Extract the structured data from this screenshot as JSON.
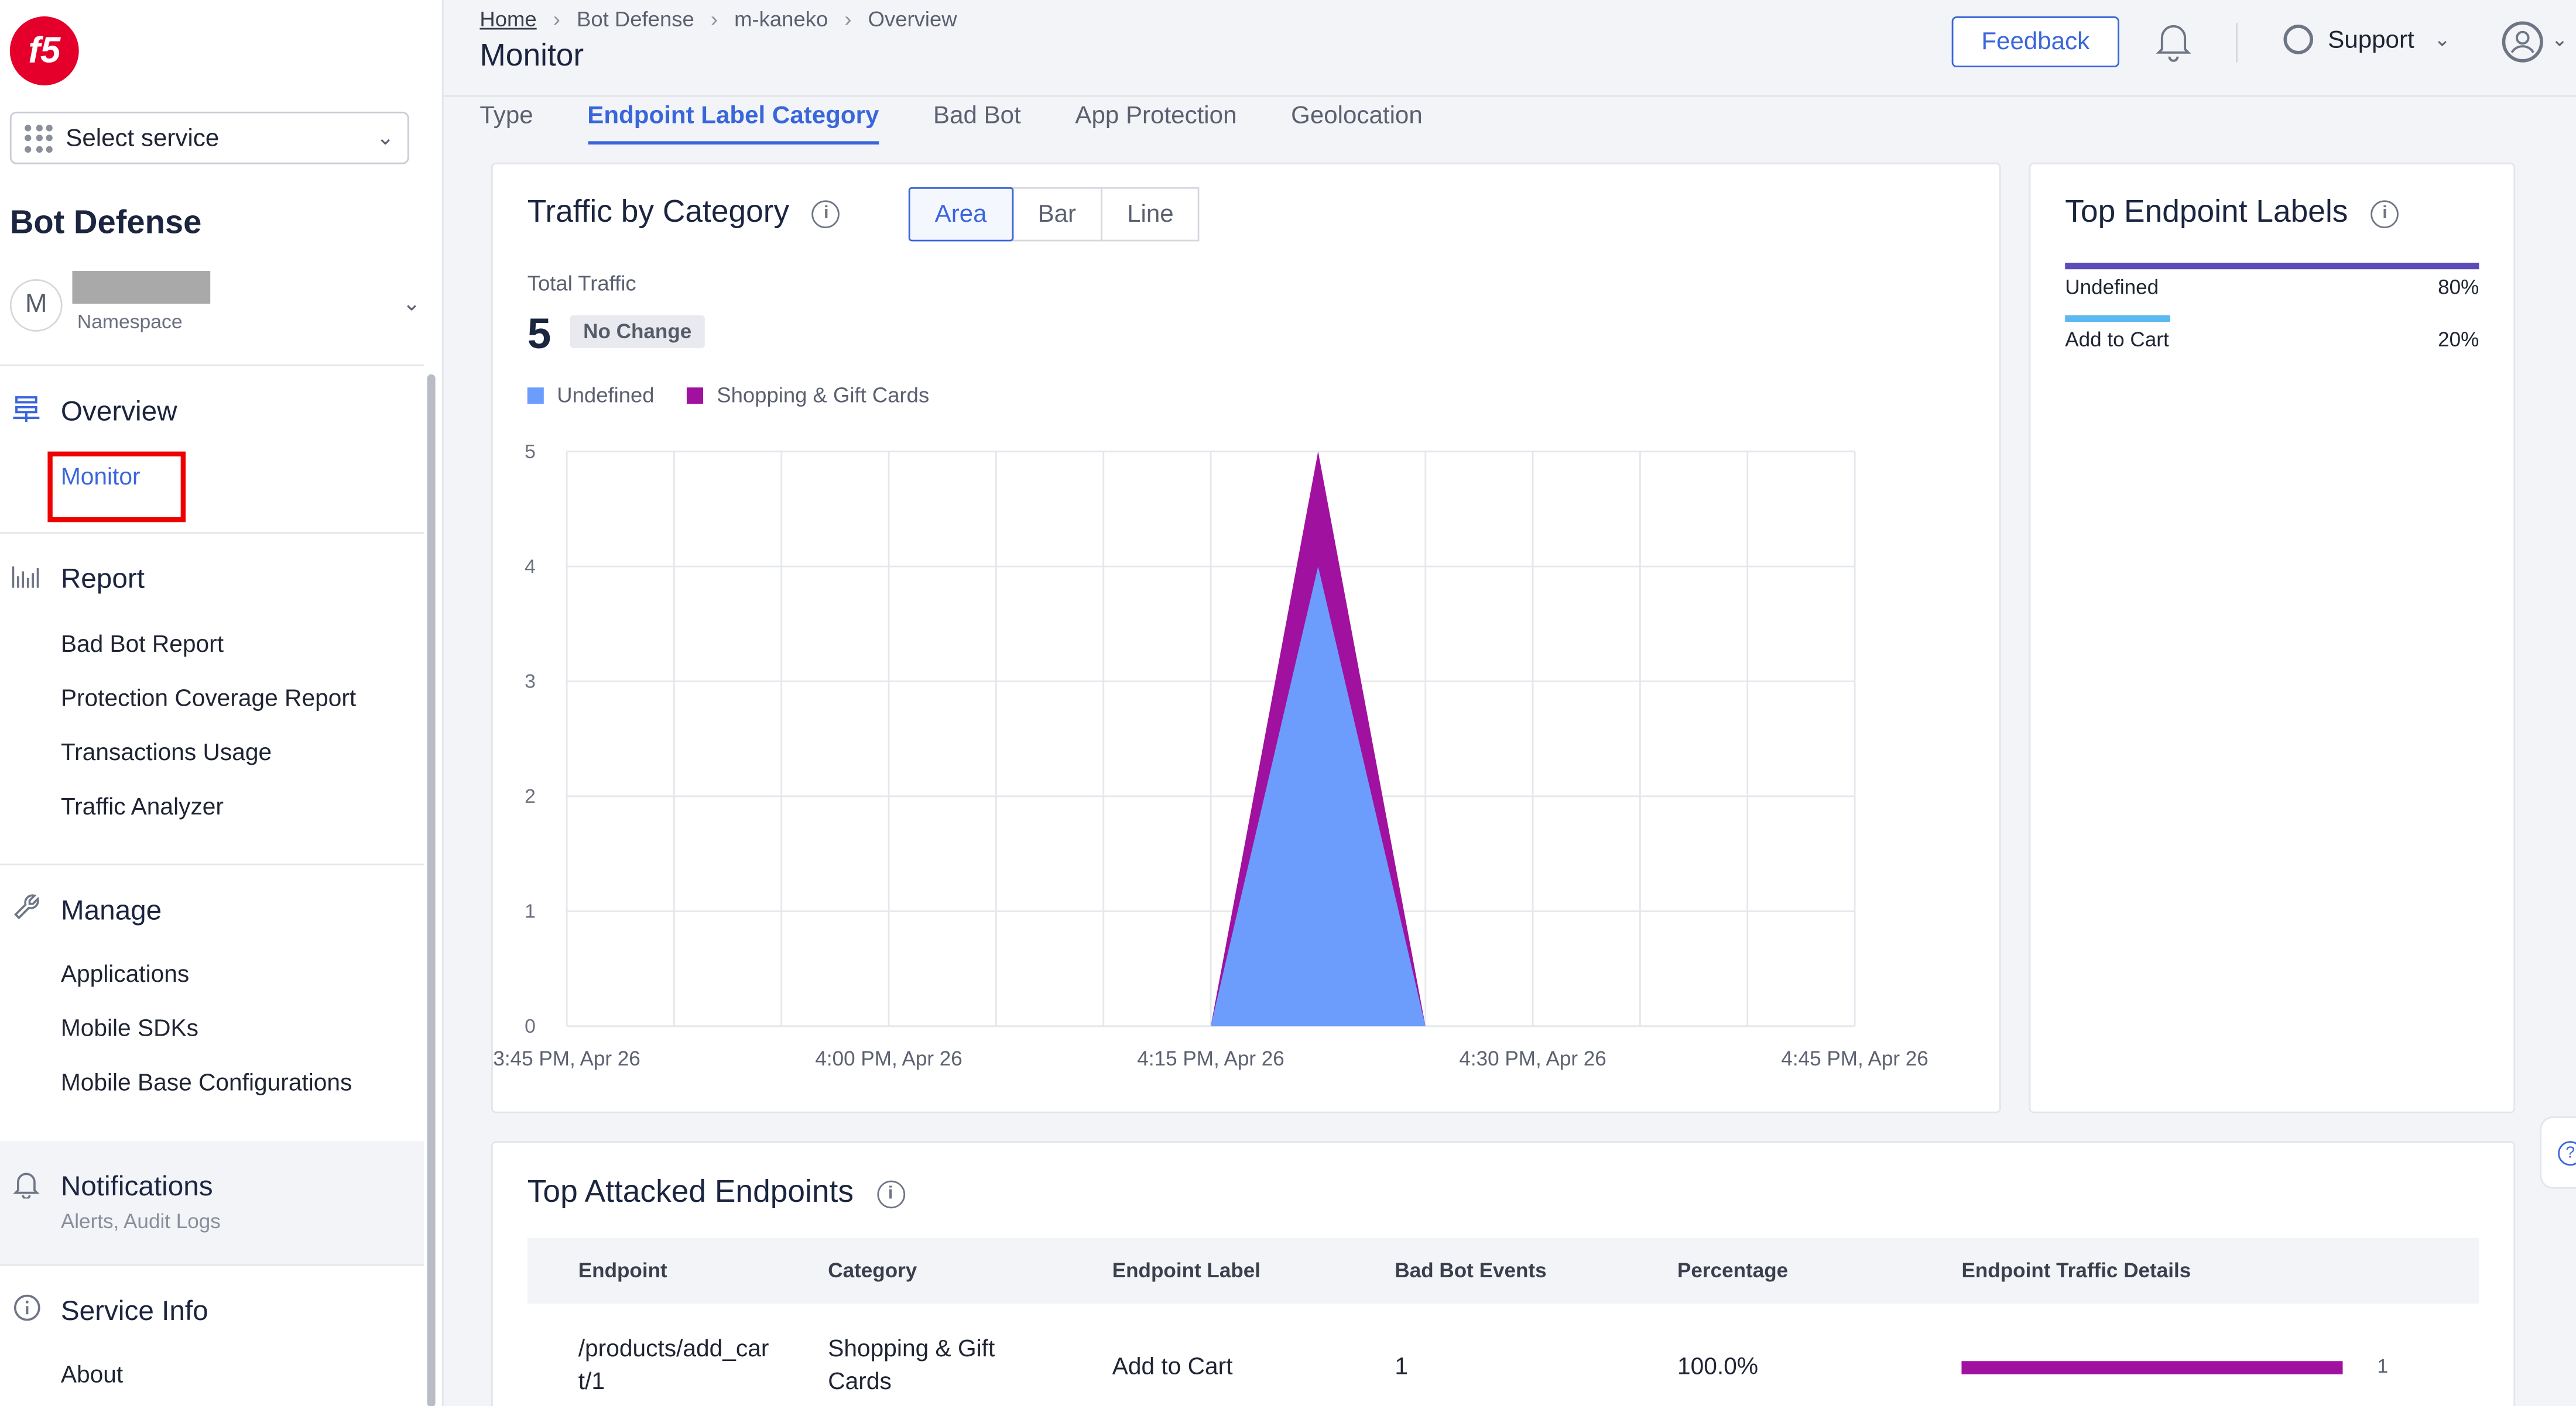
{
  "sidebar": {
    "logo": "f5",
    "service_select": "Select service",
    "app_title": "Bot Defense",
    "namespace_initial": "M",
    "namespace_label": "Namespace",
    "sections": {
      "overview": {
        "label": "Overview",
        "icon": "overview-icon",
        "items": [
          "Monitor"
        ]
      },
      "report": {
        "label": "Report",
        "icon": "report-icon",
        "items": [
          "Bad Bot Report",
          "Protection Coverage Report",
          "Transactions Usage",
          "Traffic Analyzer"
        ]
      },
      "manage": {
        "label": "Manage",
        "icon": "wrench-icon",
        "items": [
          "Applications",
          "Mobile SDKs",
          "Mobile Base Configurations"
        ]
      },
      "notifications": {
        "label": "Notifications",
        "icon": "bell-icon",
        "sub": "Alerts, Audit Logs"
      },
      "service_info": {
        "label": "Service Info",
        "icon": "info-icon",
        "items": [
          "About"
        ]
      }
    }
  },
  "header": {
    "breadcrumb": [
      "Home",
      "Bot Defense",
      "m-kaneko",
      "Overview"
    ],
    "title": "Monitor",
    "feedback": "Feedback",
    "support": "Support"
  },
  "tabs": [
    "Type",
    "Endpoint Label Category",
    "Bad Bot",
    "App Protection",
    "Geolocation"
  ],
  "active_tab": "Endpoint Label Category",
  "traffic_card": {
    "title": "Traffic by Category",
    "chart_types": [
      "Area",
      "Bar",
      "Line"
    ],
    "active_chart_type": "Area",
    "total_label": "Total Traffic",
    "total_value": "5",
    "change_badge": "No Change"
  },
  "chart_data": {
    "type": "area",
    "stacked": true,
    "x": [
      "3:45 PM, Apr 26",
      "3:50 PM, Apr 26",
      "3:55 PM, Apr 26",
      "4:00 PM, Apr 26",
      "4:05 PM, Apr 26",
      "4:10 PM, Apr 26",
      "4:15 PM, Apr 26",
      "4:20 PM, Apr 26",
      "4:25 PM, Apr 26",
      "4:30 PM, Apr 26",
      "4:35 PM, Apr 26",
      "4:40 PM, Apr 26",
      "4:45 PM, Apr 26"
    ],
    "x_tick_labels": [
      "3:45 PM, Apr 26",
      "4:00 PM, Apr 26",
      "4:15 PM, Apr 26",
      "4:30 PM, Apr 26",
      "4:45 PM, Apr 26"
    ],
    "y_ticks": [
      0,
      1,
      2,
      3,
      4,
      5
    ],
    "ylim": [
      0,
      5
    ],
    "grid": true,
    "series": [
      {
        "name": "Undefined",
        "color": "#6c9dfc",
        "values": [
          0,
          0,
          0,
          0,
          0,
          0,
          0,
          4,
          0,
          0,
          0,
          0,
          0
        ]
      },
      {
        "name": "Shopping & Gift Cards",
        "color": "#a0119f",
        "values": [
          0,
          0,
          0,
          0,
          0,
          0,
          0,
          1,
          0,
          0,
          0,
          0,
          0
        ]
      }
    ]
  },
  "top_labels": {
    "title": "Top Endpoint Labels",
    "items": [
      {
        "label": "Undefined",
        "percent": "80%",
        "value": 0.8,
        "color": "#5c4bb8"
      },
      {
        "label": "Add to Cart",
        "percent": "20%",
        "value": 0.2,
        "color": "#5bb8f0"
      }
    ]
  },
  "attacked": {
    "title": "Top Attacked Endpoints",
    "columns": [
      "Endpoint",
      "Category",
      "Endpoint Label",
      "Bad Bot Events",
      "Percentage",
      "Endpoint Traffic Details"
    ],
    "rows": [
      {
        "endpoint_1": "/products/add_car",
        "endpoint_2": "t/1",
        "category_1": "Shopping & Gift",
        "category_2": "Cards",
        "label": "Add to Cart",
        "events": "1",
        "percentage": "100.0%",
        "detail_count": "1",
        "detail_fraction": 1.0,
        "detail_color": "#a0119f"
      }
    ]
  }
}
